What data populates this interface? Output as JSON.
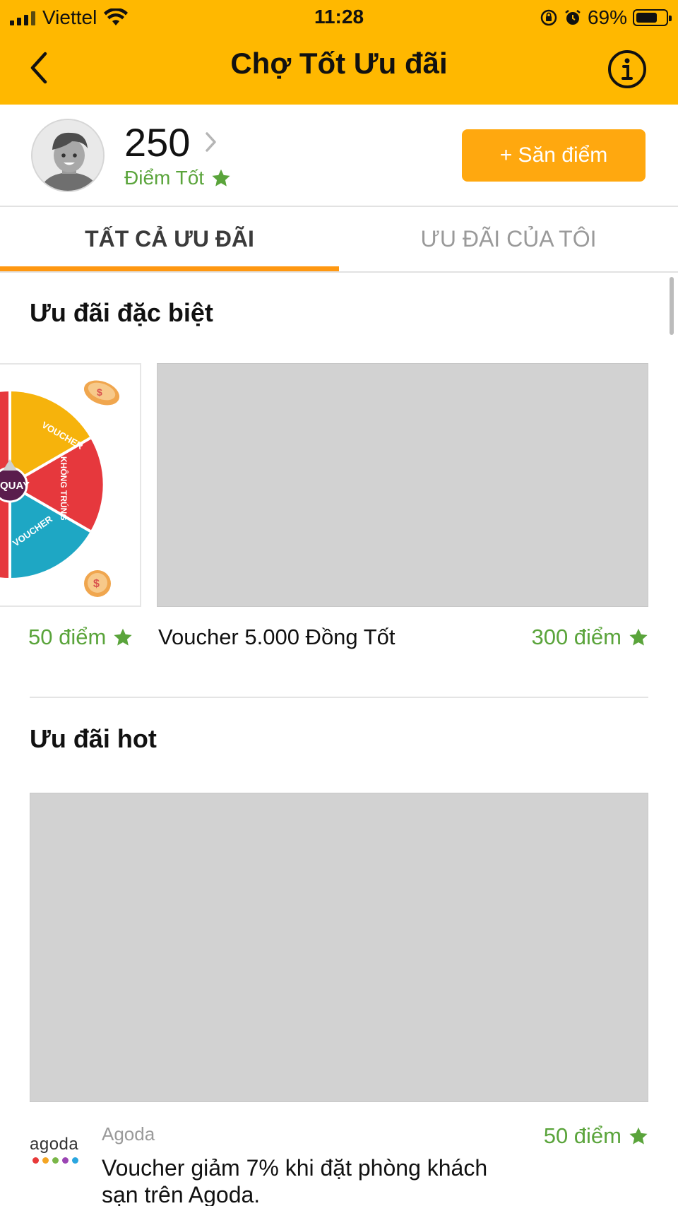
{
  "status_bar": {
    "carrier": "Viettel",
    "time": "11:28",
    "battery": "69%",
    "battery_level": 0.69
  },
  "nav": {
    "title": "Chợ Tốt Ưu đãi"
  },
  "profile": {
    "points": "250",
    "points_label": "Điểm Tốt",
    "hunt_button": "+ Săn điểm"
  },
  "tabs": {
    "all": "TẤT CẢ ƯU ĐÃI",
    "mine": "ƯU ĐÃI CỦA TÔI"
  },
  "special": {
    "title": "Ưu đãi đặc biệt",
    "wheel_points": "50 điểm",
    "wheel_labels": [
      "VOUCHER",
      "KHÔNG TRÚNG",
      "VOUCHER",
      "QUAY"
    ],
    "voucher_name": "Voucher 5.000 Đồng Tốt",
    "voucher_points": "300 điểm"
  },
  "hot": {
    "title": "Ưu đãi hot",
    "brand_logo": "agoda",
    "brand": "Agoda",
    "description": "Voucher giảm 7% khi đặt phòng khách sạn trên Agoda.",
    "points": "50 điểm"
  },
  "colors": {
    "header": "#ffb800",
    "accent": "#ffa80f",
    "points_green": "#5aa43b",
    "placeholder": "#d2d2d2"
  }
}
